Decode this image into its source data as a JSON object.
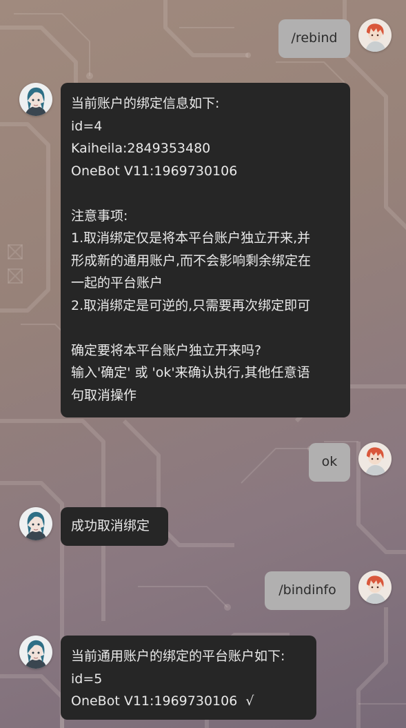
{
  "messages": [
    {
      "sender": "user",
      "text": "/rebind"
    },
    {
      "sender": "bot",
      "text": "当前账户的绑定信息如下:\nid=4\nKaiheila:2849353480\nOneBot V11:1969730106\n\n注意事项:\n1.取消绑定仅是将本平台账户独立开来,并\n形成新的通用账户,而不会影响剩余绑定在\n一起的平台账户\n2.取消绑定是可逆的,只需要再次绑定即可\n\n确定要将本平台账户独立开来吗?\n输入'确定' 或 'ok'来确认执行,其他任意语\n句取消操作"
    },
    {
      "sender": "user",
      "text": "ok"
    },
    {
      "sender": "bot",
      "text": "成功取消绑定"
    },
    {
      "sender": "user",
      "text": "/bindinfo"
    },
    {
      "sender": "bot",
      "text": "当前通用账户的绑定的平台账户如下:\nid=5\nOneBot V11:1969730106  √"
    }
  ],
  "theme": {
    "user_bubble_color": "#b1b0b0",
    "bot_bubble_color": "#262626",
    "user_avatar": "anime-boy-red-hair-avatar",
    "bot_avatar": "anime-girl-blue-hair-avatar"
  }
}
